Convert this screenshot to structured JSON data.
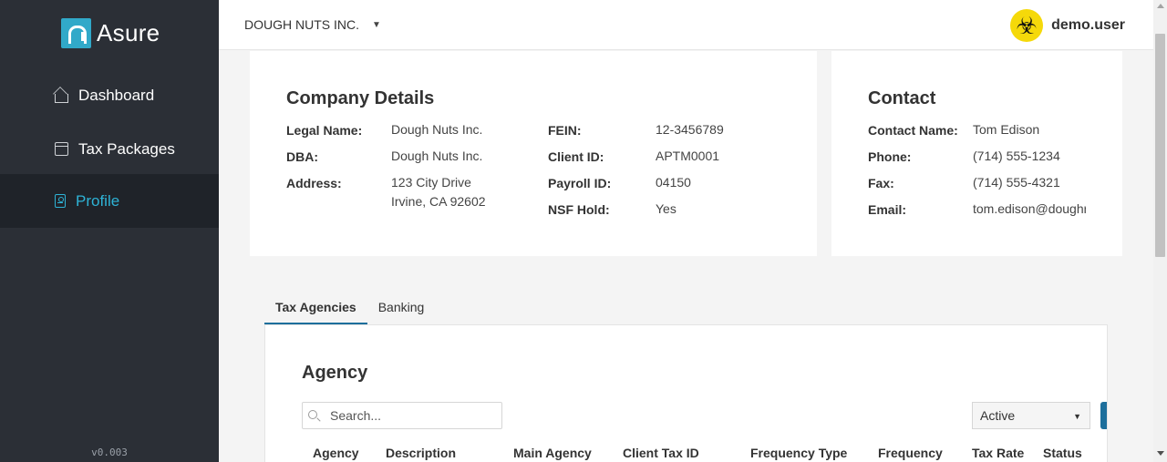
{
  "sidebar": {
    "logo_text": "Asure",
    "items": [
      {
        "label": "Dashboard",
        "icon": "home-icon"
      },
      {
        "label": "Tax Packages",
        "icon": "package-icon"
      },
      {
        "label": "Profile",
        "icon": "profile-icon"
      }
    ],
    "active_item": "Profile",
    "version": "v0.003"
  },
  "header": {
    "company": "DOUGH NUTS INC.",
    "company_caret": "▼",
    "user_name": "demo.user",
    "avatar_icon": "☣"
  },
  "company_details": {
    "title": "Company Details",
    "legal_name_label": "Legal Name:",
    "legal_name": "Dough Nuts Inc.",
    "dba_label": "DBA:",
    "dba": "Dough Nuts Inc.",
    "address_label": "Address:",
    "address_line1": "123 City Drive",
    "address_line2": "Irvine, CA 92602",
    "fein_label": "FEIN:",
    "fein": "12-3456789",
    "client_id_label": "Client ID:",
    "client_id": "APTM0001",
    "payroll_id_label": "Payroll ID:",
    "payroll_id": "04150",
    "nsf_hold_label": "NSF Hold:",
    "nsf_hold": "Yes"
  },
  "contact": {
    "title": "Contact",
    "name_label": "Contact Name:",
    "name": "Tom Edison",
    "phone_label": "Phone:",
    "phone": "(714) 555-1234",
    "fax_label": "Fax:",
    "fax": "(714) 555-4321",
    "email_label": "Email:",
    "email": "tom.edison@doughr"
  },
  "tabs": [
    {
      "label": "Tax Agencies",
      "active": true
    },
    {
      "label": "Banking",
      "active": false
    }
  ],
  "agency": {
    "title": "Agency",
    "search_placeholder": "Search...",
    "status_filter": "Active",
    "status_caret": "▼",
    "columns": [
      "Agency",
      "Description",
      "Main Agency",
      "Client Tax ID",
      "Frequency Type",
      "Frequency",
      "Tax Rate",
      "Status"
    ]
  },
  "colors": {
    "sidebar_bg": "#2b2f36",
    "accent": "#2eb3d6",
    "primary_button": "#1d6f9c",
    "avatar_bg": "#f5d90a"
  }
}
